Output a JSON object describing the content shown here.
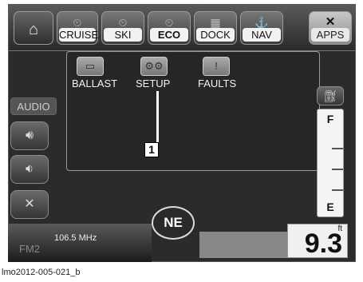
{
  "tabs": [
    {
      "label": "",
      "icon": "home-icon"
    },
    {
      "label": "CRUISE",
      "icon": "cruise-icon"
    },
    {
      "label": "SKI",
      "icon": "ski-icon"
    },
    {
      "label": "ECO",
      "icon": "eco-icon"
    },
    {
      "label": "DOCK",
      "icon": "dock-icon"
    },
    {
      "label": "NAV",
      "icon": "nav-icon"
    },
    {
      "label": "APPS",
      "icon": "apps-icon"
    }
  ],
  "side": {
    "audio_label": "AUDIO"
  },
  "apps": [
    {
      "label": "BALLAST",
      "icon": "ballast-icon"
    },
    {
      "label": "SETUP",
      "icon": "gears-icon"
    },
    {
      "label": "FAULTS",
      "icon": "warning-icon"
    }
  ],
  "callout": "1",
  "fuel": {
    "full": "F",
    "empty": "E"
  },
  "radio": {
    "band": "FM2",
    "frequency": "106.5 MHz"
  },
  "compass": "NE",
  "depth": {
    "value": "9.3",
    "unit": "ft"
  },
  "caption": "lmo2012-005-021_b"
}
